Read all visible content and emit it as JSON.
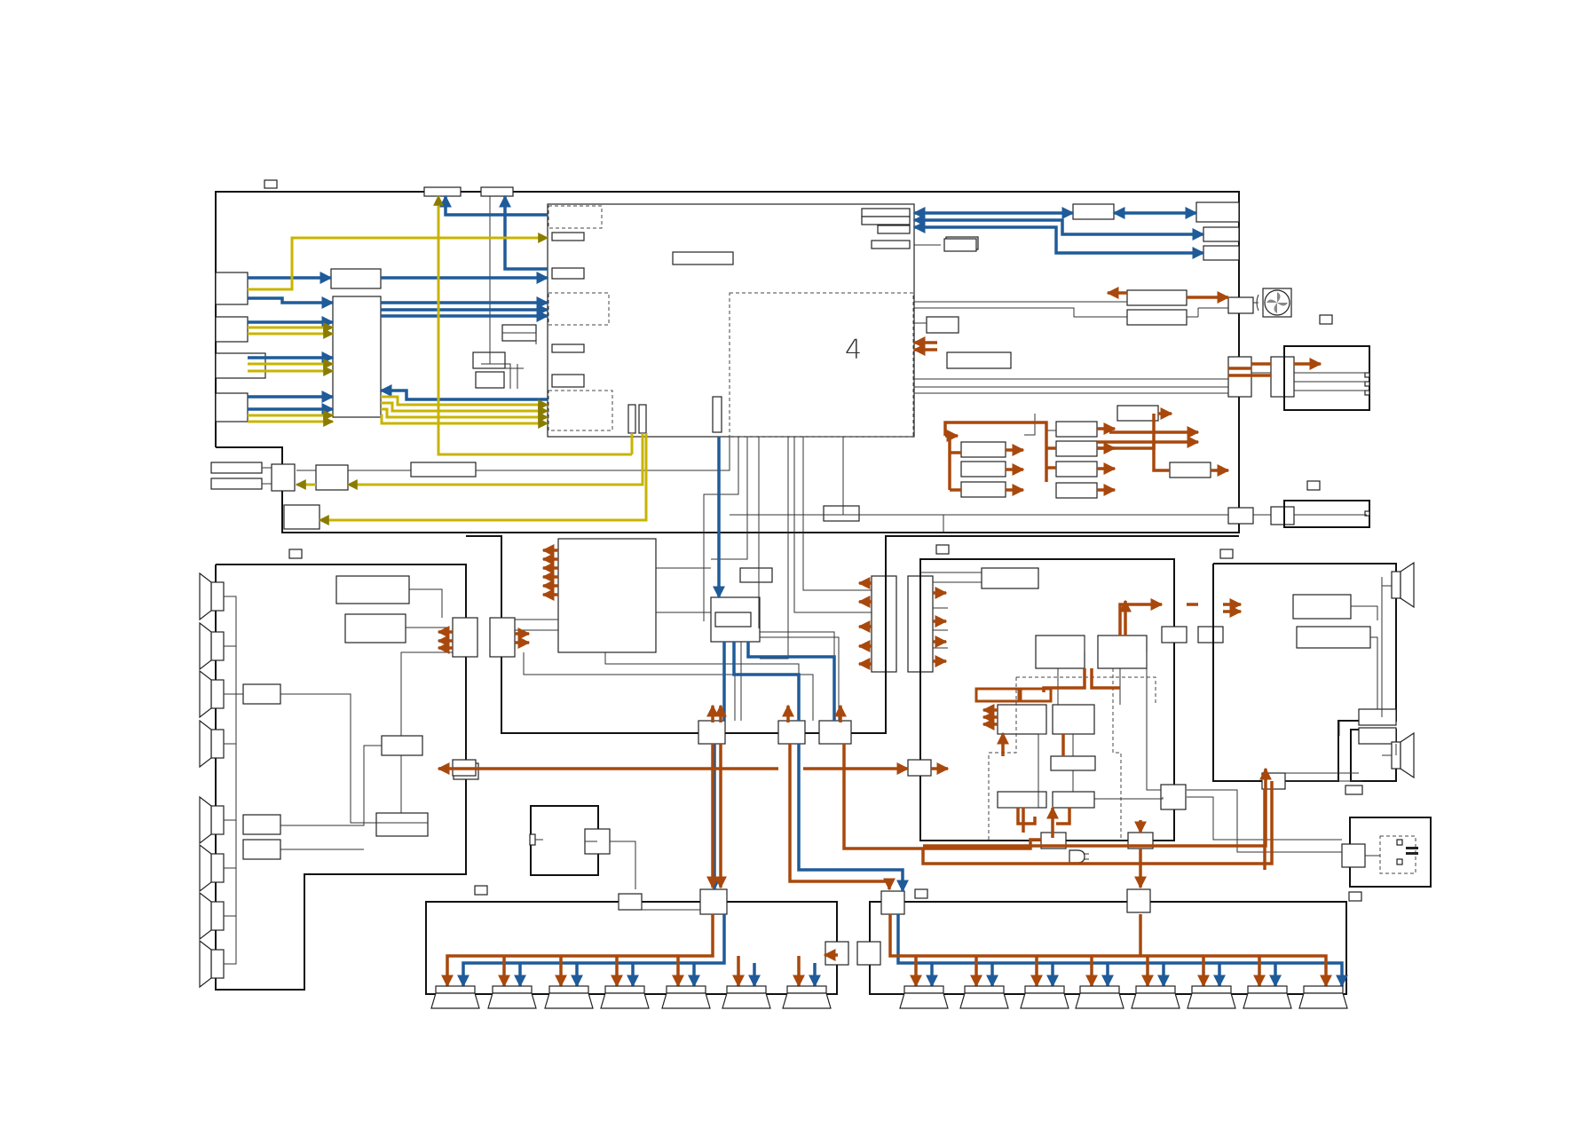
{
  "diagram": {
    "description_visible_text": "",
    "colors": {
      "line": "#111111",
      "bus_blue": "#1f5b99",
      "bus_yellow": "#c8b400",
      "bus_brown": "#a8480c",
      "background": "#ffffff"
    },
    "icons": [
      "fan-icon",
      "speaker-icon",
      "ac-plug-icon",
      "connector-icon"
    ],
    "glyph_mark": "4"
  }
}
